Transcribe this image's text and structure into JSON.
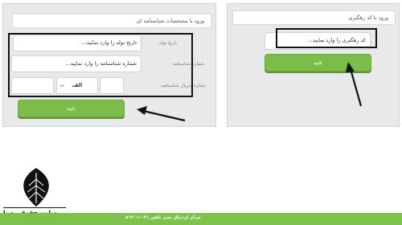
{
  "left_panel": {
    "title": "ورود با مشخصات شناسنامه ای",
    "birth_date_label": "تاریخ تولد:",
    "birth_date_placeholder": "تاریخ تولد را وارد نمایید...",
    "id_number_label": "شماره شناسنامه:",
    "id_number_placeholder": "شماره شناسنامه را وارد نمایید...",
    "serial_label": "شماره سریال شناسنامه:",
    "serial_letter_value": "الف",
    "submit_label": "تایید"
  },
  "right_panel": {
    "title": "ورود با کد رهگیری",
    "tracking_placeholder": "کد رهگیری را وارد نمایید...",
    "submit_label": "تایید"
  },
  "footer": {
    "text": "مرکز اردیبال سبز تلفن ۰۲۱-۸۱۳۰۱"
  },
  "watermark": {
    "brand": "سایت حقوقی دینا"
  },
  "colors": {
    "panel_bg": "#e8e9eb",
    "button_green": "#7cbd4a",
    "footer_green": "#7cc24b",
    "highlight": "#111111"
  }
}
